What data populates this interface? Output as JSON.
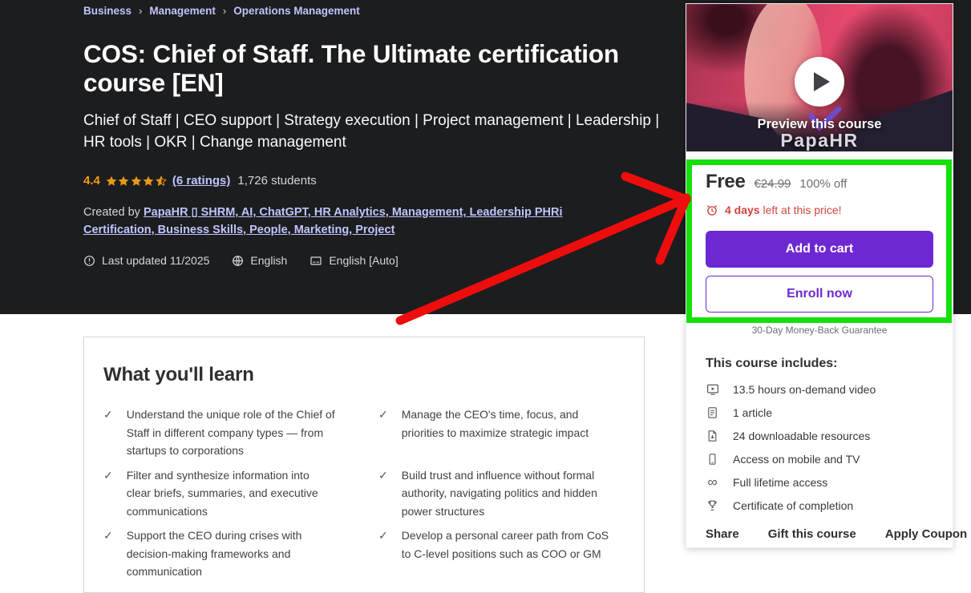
{
  "breadcrumb": {
    "separator": "›",
    "items": [
      "Business",
      "Management",
      "Operations Management"
    ]
  },
  "header": {
    "title": "COS: Chief of Staff. The Ultimate certification course [EN]",
    "subtitle": "Chief of Staff | CEO support | Strategy execution | Project management | Leadership | HR tools | OKR | Change management",
    "rating_value": "4.4",
    "ratings_link": "(6 ratings)",
    "students": "1,726 students",
    "created_by_prefix": "Created by ",
    "created_by_link": "PapaHR ▯ SHRM, AI, ChatGPT, HR Analytics, Management, Leadership PHRi Certification, Business Skills, People, Marketing, Project",
    "last_updated": "Last updated 11/2025",
    "language": "English",
    "captions": "English [Auto]"
  },
  "learn": {
    "title": "What you'll learn",
    "items": [
      "Understand the unique role of the Chief of Staff in different company types — from startups to corporations",
      "Manage the CEO's time, focus, and priorities to maximize strategic impact",
      "Filter and synthesize information into clear briefs, summaries, and executive communications",
      "Build trust and influence without formal authority, navigating politics and hidden power structures",
      "Support the CEO during crises with decision-making frameworks and communication",
      "Develop a personal career path from CoS to C-level positions such as COO or GM"
    ],
    "check_glyph": "✓"
  },
  "sidebar": {
    "preview_label": "Preview this course",
    "brand": "PapaHR",
    "price": {
      "current": "Free",
      "original": "€24.99",
      "discount": "100% off"
    },
    "urgency": {
      "bold": "4 days",
      "rest": " left at this price!"
    },
    "add_to_cart": "Add to cart",
    "enroll_now": "Enroll now",
    "guarantee": "30-Day Money-Back Guarantee",
    "includes_title": "This course includes:",
    "includes": [
      {
        "icon": "video-icon",
        "label": "13.5 hours on-demand video"
      },
      {
        "icon": "article-icon",
        "label": "1 article"
      },
      {
        "icon": "download-icon",
        "label": "24 downloadable resources"
      },
      {
        "icon": "mobile-icon",
        "label": "Access on mobile and TV"
      },
      {
        "icon": "infinity-icon",
        "label": "Full lifetime access"
      },
      {
        "icon": "trophy-icon",
        "label": "Certificate of completion"
      }
    ],
    "links": [
      "Share",
      "Gift this course",
      "Apply Coupon"
    ]
  },
  "colors": {
    "hero_bg": "#1c1d1f",
    "link_purple": "#c0c4fc",
    "button_purple": "#6d28d2",
    "star_orange": "#e59819",
    "rating_orange": "#f69c08",
    "alert_red": "#d0453e",
    "annotation_green": "#15e00a",
    "annotation_red": "#ee0d0d"
  }
}
